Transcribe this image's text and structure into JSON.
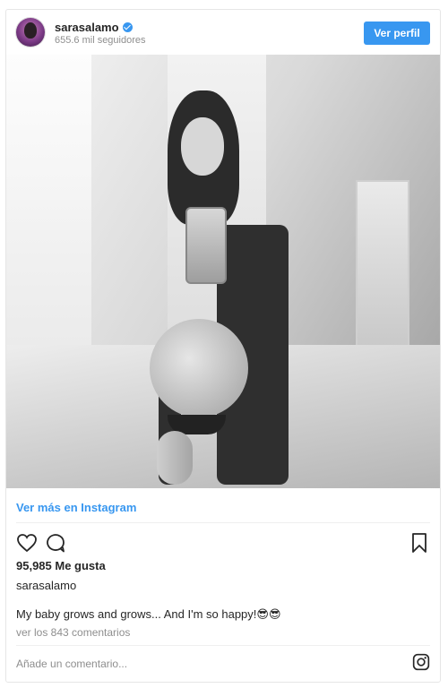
{
  "header": {
    "username": "sarasalamo",
    "followers": "655.6 mil seguidores",
    "view_profile_label": "Ver perfil"
  },
  "post": {
    "see_more_label": "Ver más en Instagram",
    "likes": "95,985 Me gusta",
    "caption_user": "sarasalamo",
    "caption_text": "My baby grows and grows... And I'm so happy!",
    "caption_emoji": "😎😎",
    "comments_link": "ver los 843 comentarios",
    "add_comment_placeholder": "Añade un comentario..."
  },
  "icons": {
    "verified": "verified-badge-icon",
    "like": "heart-icon",
    "comment": "comment-bubble-icon",
    "save": "bookmark-icon",
    "logo": "instagram-icon"
  },
  "colors": {
    "accent": "#3897f0",
    "muted": "#8e8e8e",
    "text": "#262626"
  }
}
